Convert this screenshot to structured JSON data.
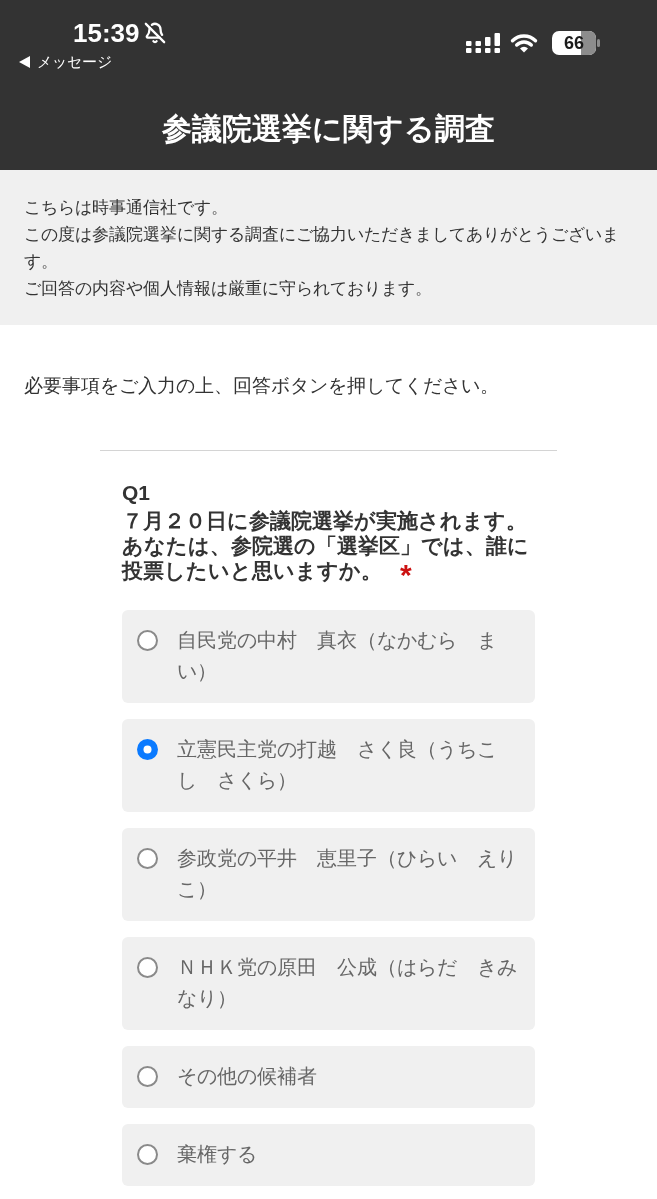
{
  "status_bar": {
    "time": "15:39",
    "back_label": "メッセージ",
    "battery": "66"
  },
  "header": {
    "title": "参議院選挙に関する調査"
  },
  "info": {
    "lines": [
      "こちらは時事通信社です。",
      "この度は参議院選挙に関する調査にご協力いただきましてありがとうございます。",
      "ご回答の内容や個人情報は厳重に守られております。"
    ]
  },
  "instruction": "必要事項をご入力の上、回答ボタンを押してください。",
  "question": {
    "number": "Q1",
    "text": "７月２０日に参議院選挙が実施されます。あなたは、参院選の「選挙区」では、誰に投票したいと思いますか。",
    "required_mark": "*",
    "options": [
      {
        "label": "自民党の中村　真衣（なかむら　まい）",
        "selected": false
      },
      {
        "label": "立憲民主党の打越　さく良（うちこし　さくら）",
        "selected": true
      },
      {
        "label": "参政党の平井　恵里子（ひらい　えりこ）",
        "selected": false
      },
      {
        "label": "ＮＨＫ党の原田　公成（はらだ　きみなり）",
        "selected": false
      },
      {
        "label": "その他の候補者",
        "selected": false
      },
      {
        "label": "棄権する",
        "selected": false
      }
    ]
  }
}
